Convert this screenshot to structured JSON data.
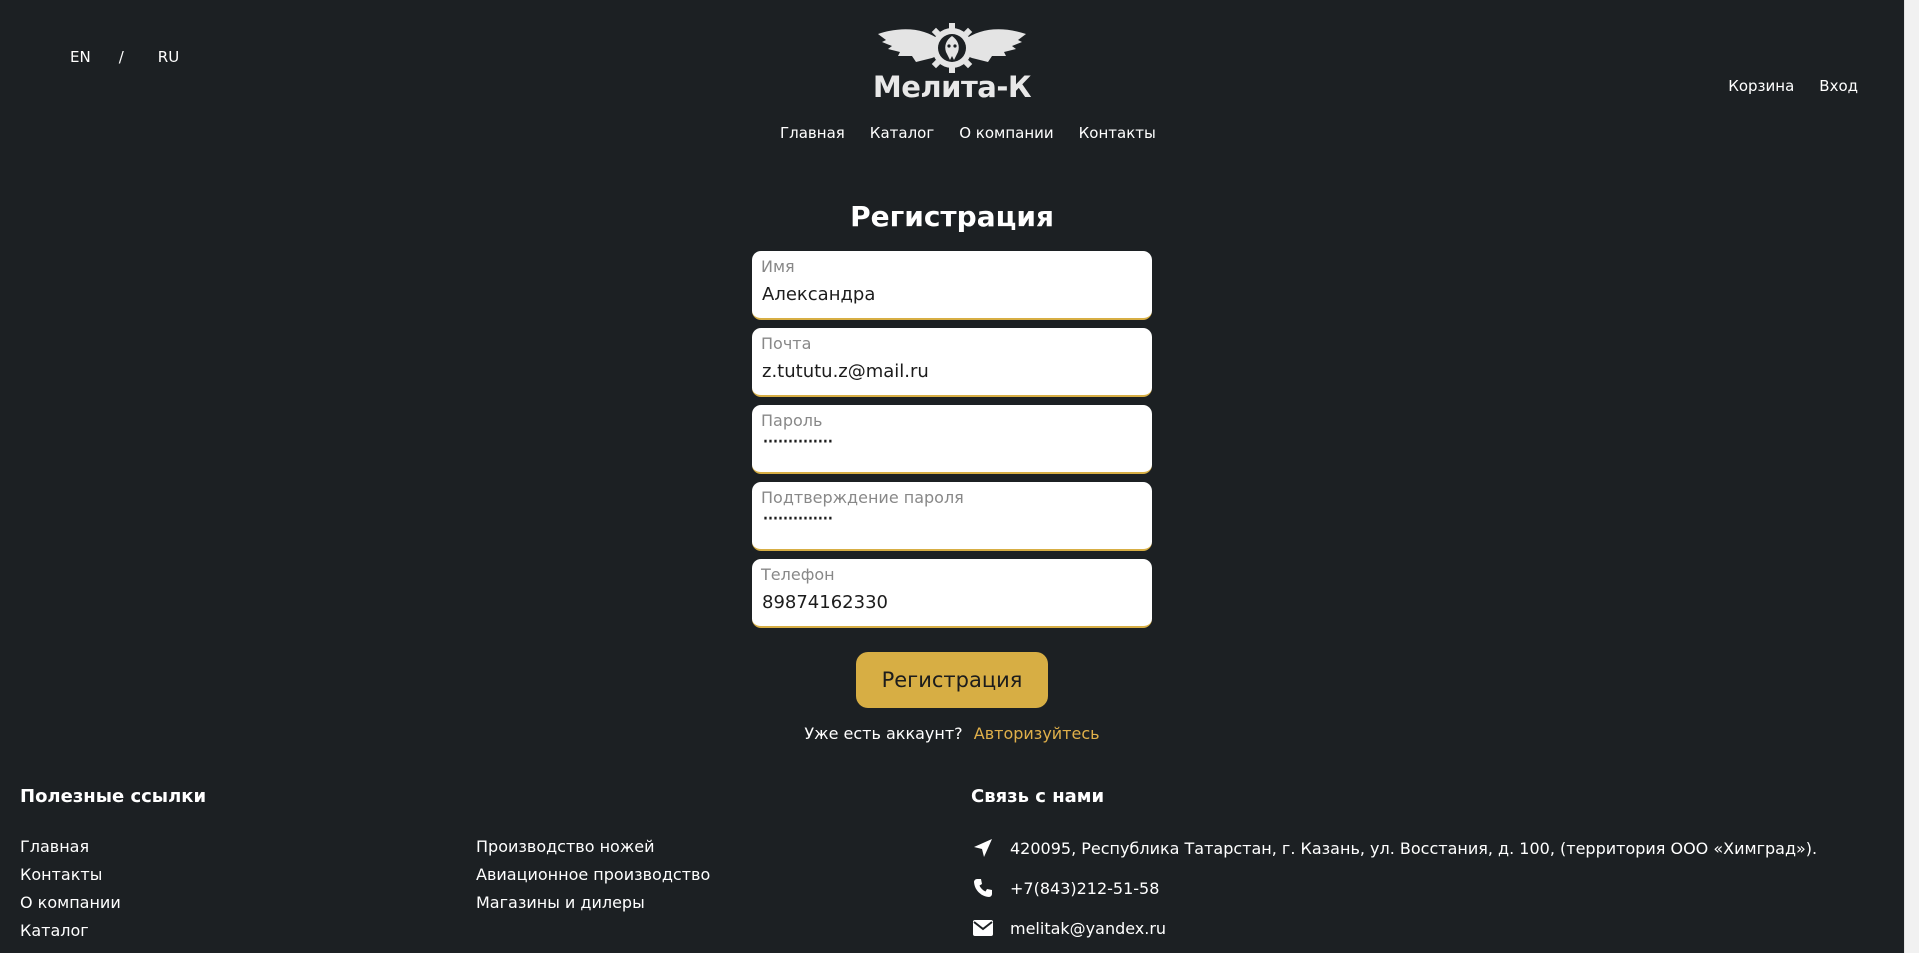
{
  "lang": {
    "en": "EN",
    "sep": "/",
    "ru": "RU"
  },
  "logo": {
    "text": "Мелита-К"
  },
  "topnav": [
    "Главная",
    "Каталог",
    "О компании",
    "Контакты"
  ],
  "userlinks": {
    "cart": "Корзина",
    "login": "Вход"
  },
  "form": {
    "title": "Регистрация",
    "fields": [
      {
        "label": "Имя",
        "value": "Александра"
      },
      {
        "label": "Почта",
        "value": "z.tututu.z@mail.ru"
      },
      {
        "label": "Пароль",
        "value": "··············"
      },
      {
        "label": "Подтверждение пароля",
        "value": "··············"
      },
      {
        "label": "Телефон",
        "value": "89874162330"
      }
    ],
    "submit": "Регистрация",
    "have_account": "Уже есть аккаунт?",
    "login_link": "Авторизуйтесь"
  },
  "footer": {
    "links_title": "Полезные ссылки",
    "links_col1": [
      "Главная",
      "Контакты",
      "О компании",
      "Каталог"
    ],
    "links_col2": [
      "Производство ножей",
      "Авиационное производство",
      "Магазины и дилеры"
    ],
    "contact_title": "Связь с нами",
    "address": "420095, Республика Татарстан, г. Казань, ул. Восстания, д. 100, (территория ООО «Химград»).",
    "phone": "+7(843)212-51-58",
    "email": "melitak@yandex.ru",
    "icons": [
      "location-arrow-icon",
      "phone-icon",
      "envelope-icon"
    ]
  },
  "colors": {
    "background": "#1c2023",
    "accent": "#d7ae44",
    "link": "#e0b04a"
  }
}
